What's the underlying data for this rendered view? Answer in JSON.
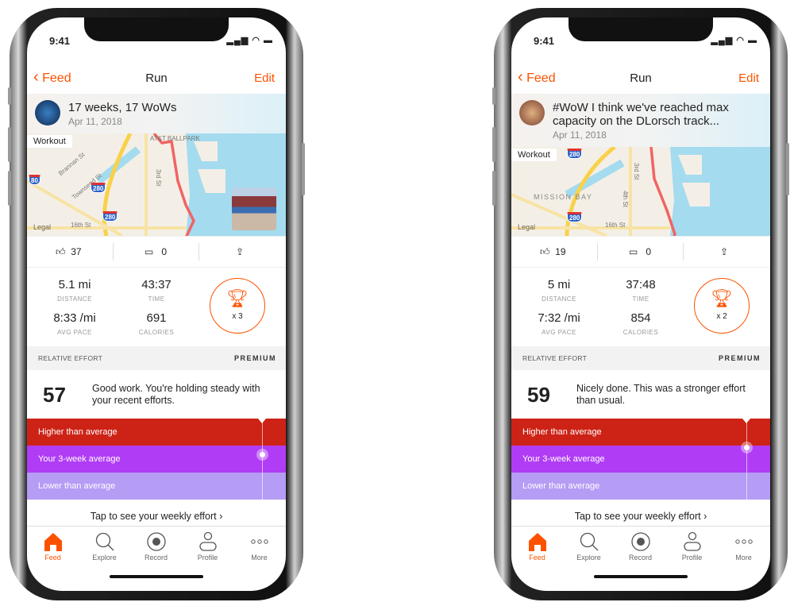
{
  "colors": {
    "brand": "#fc5200",
    "higher": "#cd2317",
    "average": "#b03df5",
    "lower": "#b59cf5"
  },
  "phones": [
    {
      "status": {
        "time": "9:41"
      },
      "nav": {
        "back": "Feed",
        "title": "Run",
        "edit": "Edit"
      },
      "post": {
        "title": "17 weeks, 17 WoWs",
        "date": "Apr 11, 2018"
      },
      "map": {
        "overlay": "Workout",
        "legal": "Legal",
        "labels": [
          "Brannan St",
          "Townsend St",
          "3rd St",
          "16th St",
          "AT&T BALLPARK",
          "80",
          "280",
          "280"
        ]
      },
      "actions": {
        "likes": "37",
        "comments": "0"
      },
      "stats": {
        "distance": "5.1 mi",
        "distance_label": "DISTANCE",
        "time": "43:37",
        "time_label": "TIME",
        "pace": "8:33 /mi",
        "pace_label": "AVG PACE",
        "calories": "691",
        "calories_label": "CALORIES",
        "trophy": "x 3"
      },
      "effort": {
        "header": "RELATIVE EFFORT",
        "premium": "PREMIUM",
        "score": "57",
        "text": "Good work. You're holding steady with your recent efforts.",
        "higher": "Higher than average",
        "average": "Your 3-week average",
        "lower": "Lower than average",
        "level": "average",
        "tap": "Tap to see your weekly effort ›"
      },
      "tabs": [
        "Feed",
        "Explore",
        "Record",
        "Profile",
        "More"
      ],
      "active_tab": "Feed"
    },
    {
      "status": {
        "time": "9:41"
      },
      "nav": {
        "back": "Feed",
        "title": "Run",
        "edit": "Edit"
      },
      "post": {
        "title": "#WoW I think we've reached max capacity on the DLorsch track...",
        "date": "Apr 11, 2018"
      },
      "map": {
        "overlay": "Workout",
        "legal": "Legal",
        "labels": [
          "MISSION BAY",
          "3rd St",
          "4th St",
          "16th St",
          "280",
          "280"
        ]
      },
      "actions": {
        "likes": "19",
        "comments": "0"
      },
      "stats": {
        "distance": "5 mi",
        "distance_label": "DISTANCE",
        "time": "37:48",
        "time_label": "TIME",
        "pace": "7:32 /mi",
        "pace_label": "AVG PACE",
        "calories": "854",
        "calories_label": "CALORIES",
        "trophy": "x 2"
      },
      "effort": {
        "header": "RELATIVE EFFORT",
        "premium": "PREMIUM",
        "score": "59",
        "text": "Nicely done. This was a stronger effort than usual.",
        "higher": "Higher than average",
        "average": "Your 3-week average",
        "lower": "Lower than average",
        "level": "upper edge of average",
        "tap": "Tap to see your weekly effort ›"
      },
      "tabs": [
        "Feed",
        "Explore",
        "Record",
        "Profile",
        "More"
      ],
      "active_tab": "Feed"
    }
  ]
}
